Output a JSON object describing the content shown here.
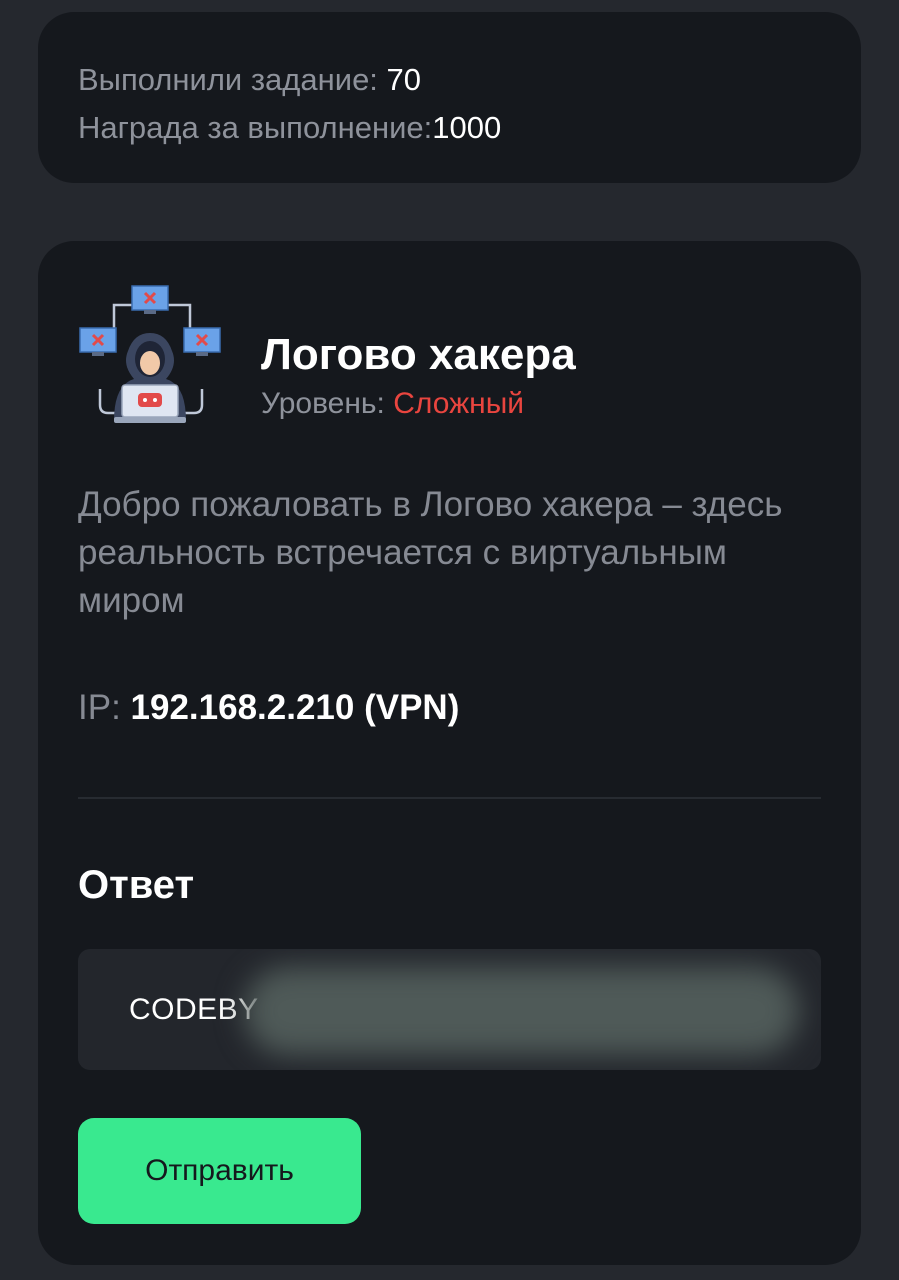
{
  "stats": {
    "completed_label": "Выполнили задание: ",
    "completed_value": "70",
    "reward_label": "Награда за выполнение:",
    "reward_value": "1000"
  },
  "task": {
    "icon": "hacker-icon",
    "title": "Логово хакера",
    "level_label": "Уровень: ",
    "level_value": "Сложный",
    "description": "Добро пожаловать в Логово хакера – здесь реальность встречается с виртуальным миром",
    "ip_label": "IP: ",
    "ip_value": "192.168.2.210 (VPN)"
  },
  "answer": {
    "heading": "Ответ",
    "value": "CODEBY"
  },
  "submit": {
    "label": "Отправить"
  },
  "colors": {
    "background": "#25282e",
    "card": "#15181d",
    "accent_green": "#39e98f",
    "level_red": "#e9453f",
    "muted_text": "#8e929b"
  }
}
